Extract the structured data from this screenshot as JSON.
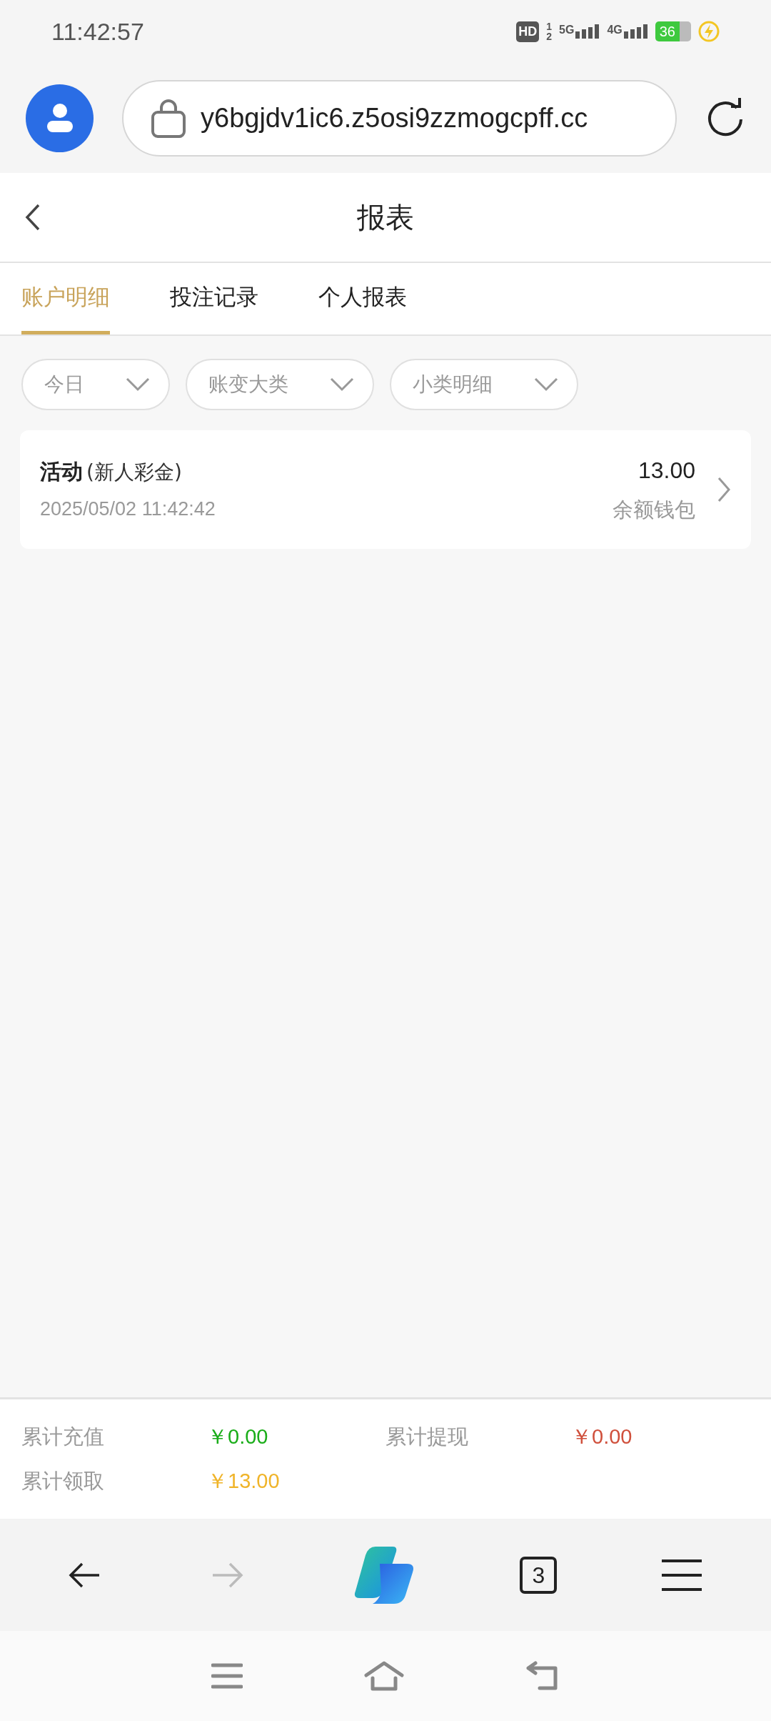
{
  "status_bar": {
    "time": "11:42:57",
    "hd_label": "HD",
    "sim_slots": [
      "1",
      "2"
    ],
    "networks": [
      "5G",
      "4G"
    ],
    "battery": "36",
    "charging": true
  },
  "browser": {
    "url": "y6bgjdv1ic6.z5osi9zzmogcpff.cc"
  },
  "header": {
    "title": "报表"
  },
  "tabs": [
    {
      "label": "账户明细",
      "selected": true
    },
    {
      "label": "投注记录",
      "selected": false
    },
    {
      "label": "个人报表",
      "selected": false
    }
  ],
  "filters": [
    {
      "label": "今日"
    },
    {
      "label": "账变大类"
    },
    {
      "label": "小类明细"
    }
  ],
  "records": [
    {
      "title": "活动",
      "subtitle": "(新人彩金)",
      "time": "2025/05/02 11:42:42",
      "amount": "13.00",
      "wallet": "余额钱包"
    }
  ],
  "summary": [
    {
      "label": "累计充值",
      "value": "￥0.00",
      "color": "#1aad19"
    },
    {
      "label": "累计提现",
      "value": "￥0.00",
      "color": "#d0503c"
    },
    {
      "label": "累计领取",
      "value": "￥13.00",
      "color": "#f0b429"
    }
  ],
  "toolbar": {
    "forward_disabled": true,
    "tab_count": "3"
  }
}
